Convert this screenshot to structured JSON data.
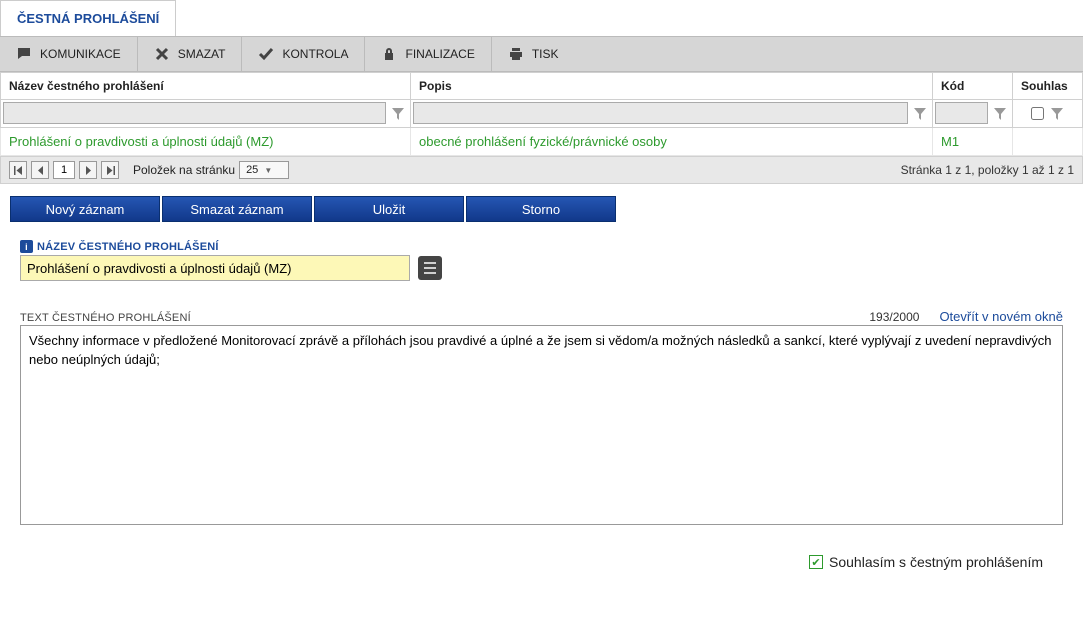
{
  "page_tab": "ČESTNÁ PROHLÁŠENÍ",
  "toolbar": {
    "komunikace": "KOMUNIKACE",
    "smazat": "SMAZAT",
    "kontrola": "KONTROLA",
    "finalizace": "FINALIZACE",
    "tisk": "TISK"
  },
  "grid": {
    "headers": {
      "nazev": "Název čestného prohlášení",
      "popis": "Popis",
      "kod": "Kód",
      "souhlas": "Souhlas"
    },
    "row": {
      "nazev": "Prohlášení o pravdivosti a úplnosti údajů (MZ)",
      "popis": "obecné prohlášení fyzické/právnické osoby",
      "kod": "M1",
      "souhlas": ""
    }
  },
  "pager": {
    "page": "1",
    "items_label": "Položek na stránku",
    "items_per_page": "25",
    "summary": "Stránka 1 z 1, položky 1 až 1 z 1"
  },
  "actions": {
    "novy": "Nový záznam",
    "smazat": "Smazat záznam",
    "ulozit": "Uložit",
    "storno": "Storno"
  },
  "form": {
    "name_label": "NÁZEV ČESTNÉHO PROHLÁŠENÍ",
    "name_value": "Prohlášení o pravdivosti a úplnosti údajů (MZ)",
    "text_label": "TEXT ČESTNÉHO PROHLÁŠENÍ",
    "char_count": "193/2000",
    "open_window": "Otevřít v novém okně",
    "text_value": "Všechny informace v předložené Monitorovací zprávě a přílohách jsou pravdivé a úplné a že jsem si vědom/a možných následků a sankcí, které vyplývají z uvedení nepravdivých nebo neúplných údajů;"
  },
  "consent_label": "Souhlasím s čestným prohlášením"
}
